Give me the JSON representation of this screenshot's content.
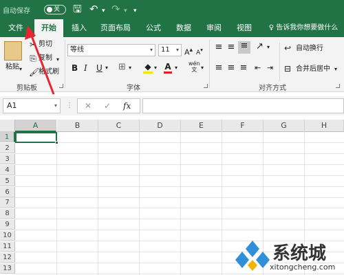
{
  "titlebar": {
    "autosave_label": "自动保存",
    "autosave_state": "关"
  },
  "tabs": [
    "文件",
    "开始",
    "插入",
    "页面布局",
    "公式",
    "数据",
    "审阅",
    "视图"
  ],
  "active_tab": "开始",
  "tell_me": "告诉我你想要做什么",
  "ribbon": {
    "paste": "粘贴",
    "cut": "剪切",
    "copy": "复制",
    "format_painter": "格式刷",
    "clipboard_group": "剪贴板",
    "font_name": "等线",
    "font_size": "11",
    "bold": "B",
    "italic": "I",
    "underline": "U",
    "font_group": "字体",
    "wrap_text": "自动换行",
    "merge_center": "合并后居中",
    "alignment_group": "对齐方式",
    "phonetic": "wén"
  },
  "formula_bar": {
    "name_box": "A1",
    "cancel": "✕",
    "enter": "✓",
    "fx": "fx",
    "formula": ""
  },
  "columns": [
    "A",
    "B",
    "C",
    "D",
    "E",
    "F",
    "G",
    "H"
  ],
  "rows": [
    "1",
    "2",
    "3",
    "4",
    "5",
    "6",
    "7",
    "8",
    "9",
    "10",
    "11",
    "12",
    "13"
  ],
  "selected_cell": "A1",
  "watermark": {
    "text": "系统城",
    "url": "xitongcheng.com"
  },
  "colors": {
    "accent": "#217346",
    "annotation_arrow": "#e8262f"
  }
}
